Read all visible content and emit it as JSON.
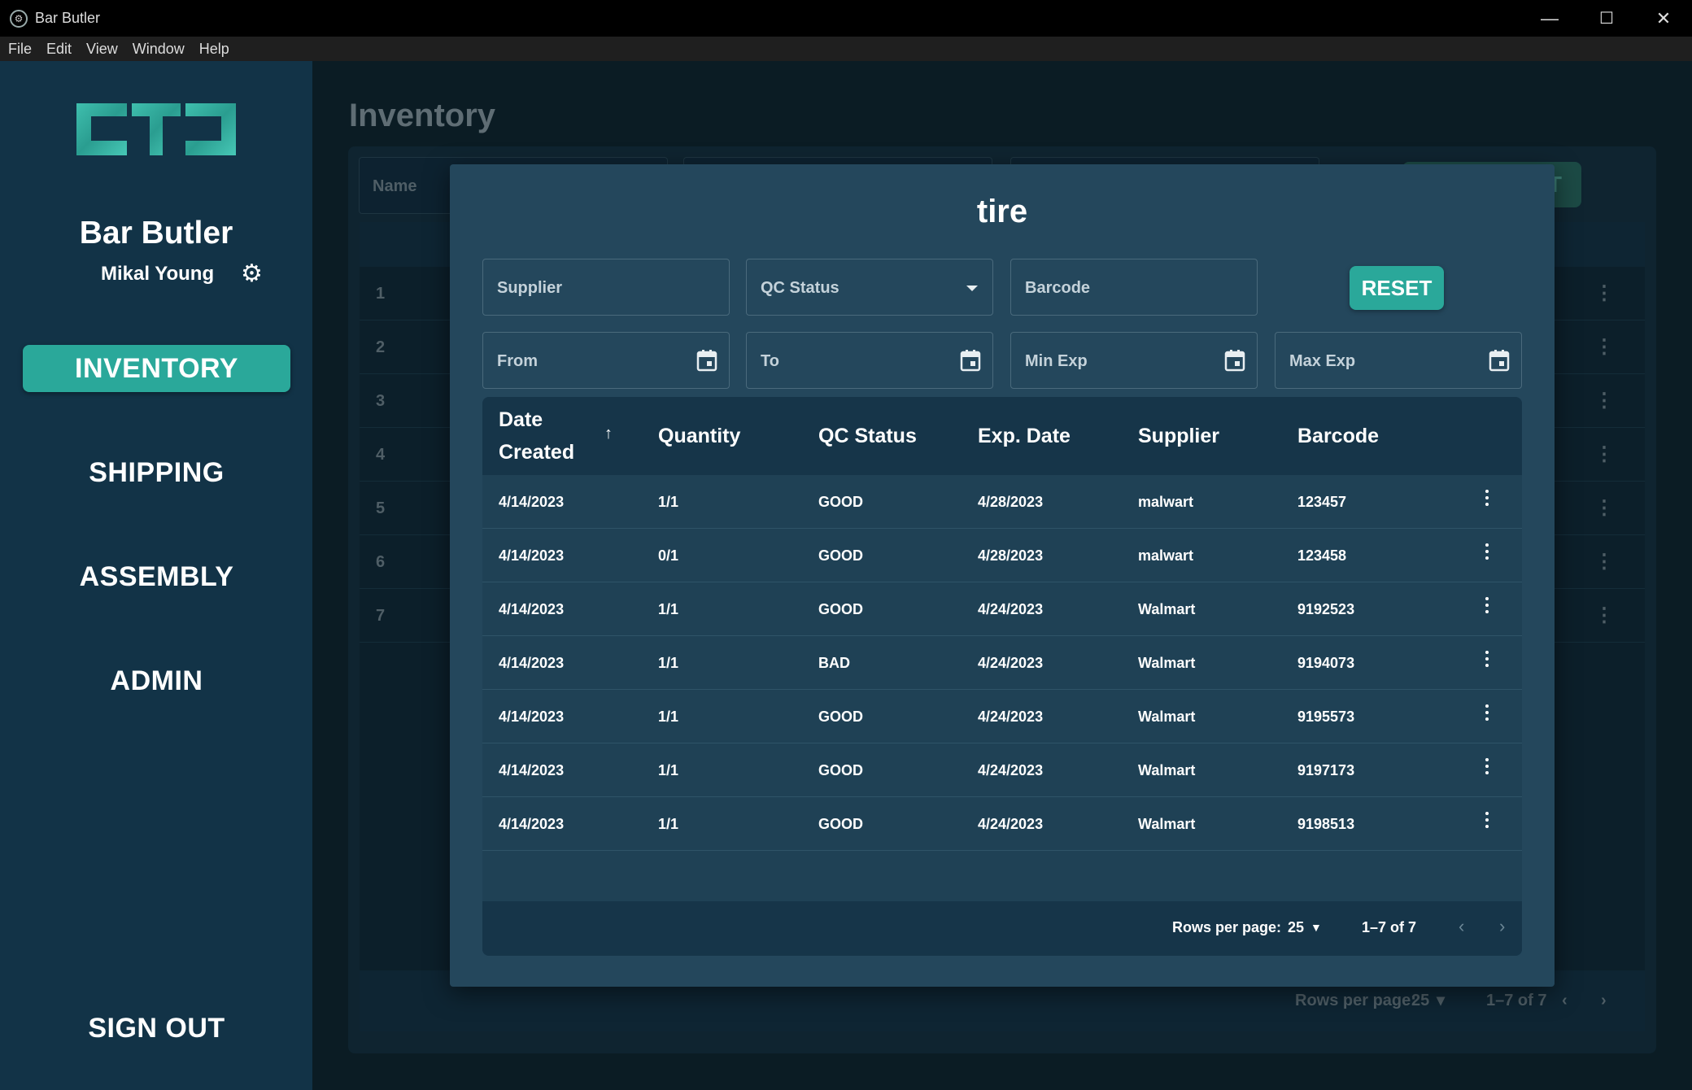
{
  "window": {
    "title": "Bar Butler",
    "minimize": "—",
    "maximize": "☐",
    "close": "✕"
  },
  "menu": [
    "File",
    "Edit",
    "View",
    "Window",
    "Help"
  ],
  "sidebar": {
    "brand": "Bar Butler",
    "user": "Mikal Young",
    "nav": [
      {
        "label": "INVENTORY",
        "active": true
      },
      {
        "label": "SHIPPING",
        "active": false
      },
      {
        "label": "ASSEMBLY",
        "active": false
      },
      {
        "label": "ADMIN",
        "active": false
      }
    ],
    "sign_out": "SIGN OUT",
    "accent": "#2aa89a"
  },
  "background_page": {
    "title": "Inventory",
    "filter_name_placeholder": "Name",
    "add_button_tail": "T",
    "row_numbers": [
      "1",
      "2",
      "3",
      "4",
      "5",
      "6",
      "7"
    ],
    "footer": {
      "rows_per_page_label": "Rows per page:",
      "rows_per_page": "25",
      "range": "1–7 of 7"
    }
  },
  "modal": {
    "title": "tire",
    "filters": {
      "supplier": "Supplier",
      "qc_status": "QC Status",
      "barcode": "Barcode",
      "from": "From",
      "to": "To",
      "min_exp": "Min Exp",
      "max_exp": "Max Exp"
    },
    "reset_label": "RESET",
    "table": {
      "headers": {
        "date_created_line1": "Date",
        "date_created_line2": "Created",
        "quantity": "Quantity",
        "qc_status": "QC Status",
        "exp_date": "Exp. Date",
        "supplier": "Supplier",
        "barcode": "Barcode"
      },
      "sort_icon": "↑",
      "rows": [
        {
          "date": "4/14/2023",
          "qty": "1/1",
          "qc": "GOOD",
          "exp": "4/28/2023",
          "supplier": "malwart",
          "barcode": "123457"
        },
        {
          "date": "4/14/2023",
          "qty": "0/1",
          "qc": "GOOD",
          "exp": "4/28/2023",
          "supplier": "malwart",
          "barcode": "123458"
        },
        {
          "date": "4/14/2023",
          "qty": "1/1",
          "qc": "GOOD",
          "exp": "4/24/2023",
          "supplier": "Walmart",
          "barcode": "9192523"
        },
        {
          "date": "4/14/2023",
          "qty": "1/1",
          "qc": "BAD",
          "exp": "4/24/2023",
          "supplier": "Walmart",
          "barcode": "9194073"
        },
        {
          "date": "4/14/2023",
          "qty": "1/1",
          "qc": "GOOD",
          "exp": "4/24/2023",
          "supplier": "Walmart",
          "barcode": "9195573"
        },
        {
          "date": "4/14/2023",
          "qty": "1/1",
          "qc": "GOOD",
          "exp": "4/24/2023",
          "supplier": "Walmart",
          "barcode": "9197173"
        },
        {
          "date": "4/14/2023",
          "qty": "1/1",
          "qc": "GOOD",
          "exp": "4/24/2023",
          "supplier": "Walmart",
          "barcode": "9198513"
        }
      ],
      "footer": {
        "rows_per_page_label": "Rows per page:",
        "rows_per_page": "25",
        "range": "1–7 of 7",
        "prev": "‹",
        "next": "›"
      }
    }
  }
}
